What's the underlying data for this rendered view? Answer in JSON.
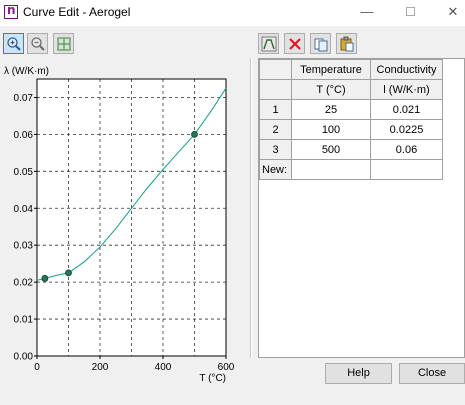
{
  "window": {
    "title": "Curve Edit - Aerogel",
    "minimize_glyph": "—",
    "close_glyph": "✕"
  },
  "left_toolbar": {
    "buttons": [
      {
        "icon": "zoom-in-icon",
        "pressed": true
      },
      {
        "icon": "zoom-out-icon",
        "pressed": false
      },
      {
        "icon": "fit-grid-icon",
        "pressed": false
      }
    ]
  },
  "right_toolbar": {
    "buttons": [
      {
        "icon": "curve-fit-icon"
      },
      {
        "icon": "delete-icon"
      },
      {
        "icon": "copy-icon"
      },
      {
        "icon": "paste-icon"
      }
    ]
  },
  "table": {
    "headers": [
      "Temperature",
      "Conductivity"
    ],
    "units": [
      "T (°C)",
      "l (W/K·m)"
    ],
    "rows": [
      {
        "index": "1",
        "temperature": "25",
        "conductivity": "0.021"
      },
      {
        "index": "2",
        "temperature": "100",
        "conductivity": "0.0225"
      },
      {
        "index": "3",
        "temperature": "500",
        "conductivity": "0.06"
      }
    ],
    "new_row_label": "New:"
  },
  "buttons": {
    "help": "Help",
    "close": "Close"
  },
  "colors": {
    "curve": "#1a9e86",
    "point_fill": "#1f7a55",
    "pressed_bg": "#cce4f7",
    "delete_red": "#e81123"
  },
  "chart_data": {
    "type": "line",
    "ylabel": "λ (W/K·m)",
    "xlabel": "T (°C)",
    "xlim": [
      0,
      600
    ],
    "ylim": [
      0,
      0.075
    ],
    "xticks": [
      "0",
      "200",
      "400",
      "600"
    ],
    "yticks": [
      "0.00",
      "0.01",
      "0.02",
      "0.03",
      "0.04",
      "0.05",
      "0.06",
      "0.07"
    ],
    "grid": true,
    "grid_x_step": 100,
    "grid_y_step": 0.01,
    "points": [
      {
        "x": 25,
        "y": 0.021
      },
      {
        "x": 100,
        "y": 0.0225
      },
      {
        "x": 500,
        "y": 0.06
      }
    ],
    "curve": [
      {
        "x": 0,
        "y": 0.0205
      },
      {
        "x": 25,
        "y": 0.021
      },
      {
        "x": 60,
        "y": 0.0218
      },
      {
        "x": 100,
        "y": 0.0225
      },
      {
        "x": 150,
        "y": 0.0255
      },
      {
        "x": 200,
        "y": 0.0295
      },
      {
        "x": 250,
        "y": 0.0345
      },
      {
        "x": 300,
        "y": 0.04
      },
      {
        "x": 350,
        "y": 0.0455
      },
      {
        "x": 400,
        "y": 0.0505
      },
      {
        "x": 450,
        "y": 0.0553
      },
      {
        "x": 500,
        "y": 0.06
      },
      {
        "x": 550,
        "y": 0.066
      },
      {
        "x": 600,
        "y": 0.0725
      }
    ]
  }
}
